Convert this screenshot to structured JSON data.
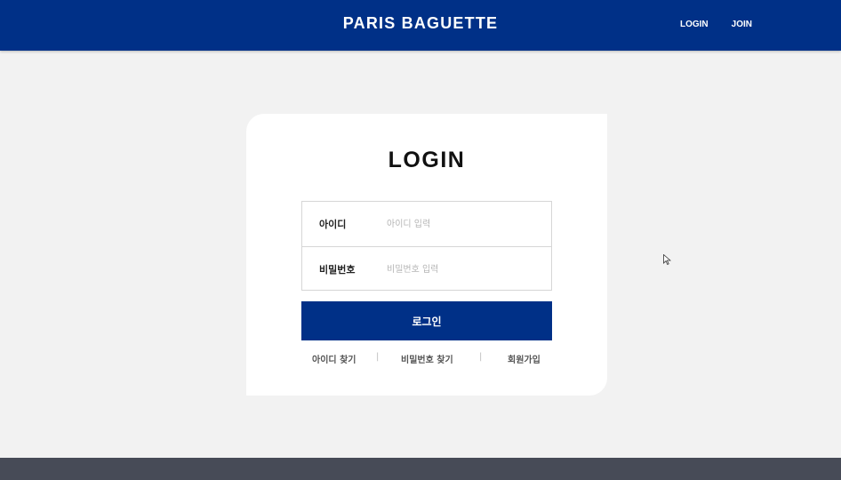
{
  "header": {
    "brand": "PARIS BAGUETTE",
    "nav": {
      "login": "LOGIN",
      "join": "JOIN"
    }
  },
  "login_card": {
    "title": "LOGIN",
    "id_field": {
      "label": "아이디",
      "placeholder": "아이디 입력",
      "value": ""
    },
    "password_field": {
      "label": "비밀번호",
      "placeholder": "비밀번호 입력",
      "value": ""
    },
    "submit_label": "로그인",
    "links": {
      "find_id": "아이디 찾기",
      "find_password": "비밀번호 찾기",
      "sign_up": "회원가입"
    },
    "separator": "|"
  },
  "colors": {
    "brand_blue": "#003087",
    "page_bg": "#f2f2f2",
    "footer_bg": "#474b57"
  },
  "icons": {
    "cursor": "mouse-pointer-icon"
  }
}
